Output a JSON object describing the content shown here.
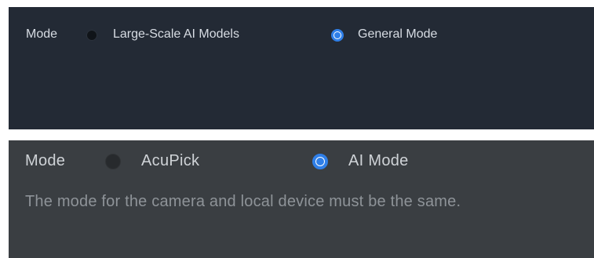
{
  "top_panel": {
    "mode_label": "Mode",
    "options": [
      {
        "label": "Large-Scale AI Models",
        "selected": false
      },
      {
        "label": "General Mode",
        "selected": true
      }
    ]
  },
  "bottom_panel": {
    "mode_label": "Mode",
    "options": [
      {
        "label": "AcuPick",
        "selected": false
      },
      {
        "label": "AI Mode",
        "selected": true
      }
    ],
    "hint": "The mode for the camera and local device must be the same."
  },
  "colors": {
    "top_panel_bg": "#232a35",
    "bottom_panel_bg": "#3a3e42",
    "accent": "#2f7fe8",
    "text": "#d7dce3",
    "hint_text": "#8e9398"
  }
}
